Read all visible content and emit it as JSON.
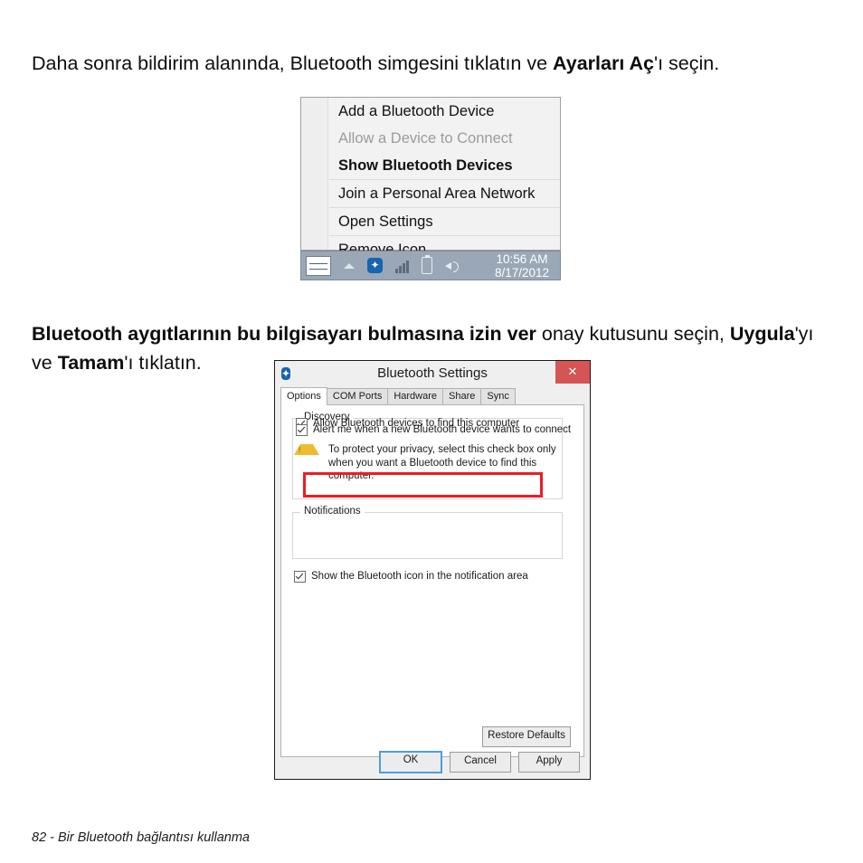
{
  "page": {
    "paragraph_1": {
      "part_1": "Daha sonra bildirim alanında, Bluetooth simgesini tıklatın ve ",
      "bold_1": "Ayarları Aç",
      "part_2": "'ı seçin."
    },
    "paragraph_2": {
      "bold_1": "Bluetooth aygıtlarının bu bilgisayarı bulmasına izin ver",
      "part_1": " onay kutusunu seçin, ",
      "bold_2": "Uygula",
      "part_2": "'yı ve ",
      "bold_3": "Tamam",
      "part_3": "'ı tıklatın."
    },
    "footer": "82 - Bir Bluetooth bağlantısı kullanma"
  },
  "tray_menu": {
    "group_1": [
      {
        "label": "Add a Bluetooth Device",
        "state": "normal"
      },
      {
        "label": "Allow a Device to Connect",
        "state": "disabled"
      },
      {
        "label": "Show Bluetooth Devices",
        "state": "bold"
      }
    ],
    "group_2": [
      {
        "label": "Join a Personal Area Network",
        "state": "normal"
      }
    ],
    "group_3": [
      {
        "label": "Open Settings",
        "state": "normal"
      }
    ],
    "group_4": [
      {
        "label": "Remove Icon",
        "state": "normal"
      }
    ]
  },
  "taskbar": {
    "icons": [
      "keyboard-icon",
      "tray-overflow-arrow-icon",
      "bluetooth-icon",
      "network-signal-icon",
      "battery-icon",
      "volume-icon"
    ],
    "bluetooth_glyph": "✦",
    "clock_time": "10:56 AM",
    "clock_date": "8/17/2012",
    "background_color": "#9aa7b7"
  },
  "dialog": {
    "title": "Bluetooth Settings",
    "title_icon": "bluetooth-icon",
    "close_label": "✕",
    "close_color": "#d55454",
    "tabs": [
      {
        "label": "Options",
        "active": true
      },
      {
        "label": "COM Ports",
        "active": false
      },
      {
        "label": "Hardware",
        "active": false
      },
      {
        "label": "Share",
        "active": false
      },
      {
        "label": "Sync",
        "active": false
      }
    ],
    "discovery": {
      "legend": "Discovery",
      "checkbox_label": "Allow Bluetooth devices to find this computer",
      "checkbox_checked": true,
      "warning_text": "To protect your privacy, select this check box only when you want a Bluetooth device to find this computer.",
      "highlight_color": "#ed1c24"
    },
    "notifications": {
      "legend": "Notifications",
      "checkbox_label": "Alert me when a new Bluetooth device wants to connect",
      "checkbox_checked": true
    },
    "show_icon": {
      "checkbox_label": "Show the Bluetooth icon in the notification area",
      "checkbox_checked": true
    },
    "restore_defaults_label": "Restore Defaults",
    "buttons": [
      {
        "label": "OK",
        "default": true
      },
      {
        "label": "Cancel",
        "default": false
      },
      {
        "label": "Apply",
        "default": false
      }
    ]
  }
}
